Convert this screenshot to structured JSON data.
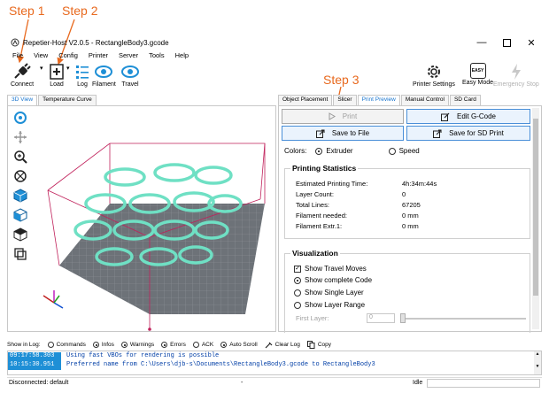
{
  "annotations": {
    "step1": "Step 1",
    "step2": "Step 2",
    "step3": "Step 3",
    "color": "#e8691e"
  },
  "window": {
    "title": "Repetier-Host V2.0.5 - RectangleBody3.gcode",
    "minimize_icon": "minimize-icon",
    "maximize_icon": "maximize-icon",
    "close_icon": "close-icon"
  },
  "menu": [
    "File",
    "View",
    "Config",
    "Printer",
    "Server",
    "Tools",
    "Help"
  ],
  "toolbar": {
    "connect": "Connect",
    "load": "Load",
    "log": "Log",
    "filament": "Filament",
    "travel": "Travel",
    "printer_settings": "Printer Settings",
    "easy_mode": "Easy Mode",
    "easy_badge": "EASY",
    "emergency_stop": "Emergency Stop"
  },
  "left_tabs": [
    "3D View",
    "Temperature Curve"
  ],
  "right_tabs": [
    "Object Placement",
    "Slicer",
    "Print Preview",
    "Manual Control",
    "SD Card"
  ],
  "buttons": {
    "print": "Print",
    "edit_gcode": "Edit G-Code",
    "save_file": "Save to File",
    "save_sd": "Save for SD Print"
  },
  "colors_row": {
    "label": "Colors:",
    "extruder": "Extruder",
    "speed": "Speed"
  },
  "printing_statistics": {
    "title": "Printing Statistics",
    "rows": [
      {
        "label": "Estimated Printing Time:",
        "value": "4h:34m:44s"
      },
      {
        "label": "Layer Count:",
        "value": "0"
      },
      {
        "label": "Total Lines:",
        "value": "67205"
      },
      {
        "label": "Filament needed:",
        "value": "0 mm"
      },
      {
        "label": "Filament Extr.1:",
        "value": "0 mm"
      }
    ]
  },
  "visualization": {
    "title": "Visualization",
    "show_travel": "Show Travel Moves",
    "show_complete": "Show complete Code",
    "show_single": "Show Single Layer",
    "show_range": "Show Layer Range",
    "first_layer_label": "First Layer:",
    "first_layer_value": "0"
  },
  "logbar": {
    "show_in_log": "Show in Log:",
    "commands": "Commands",
    "infos": "Infos",
    "warnings": "Warnings",
    "errors": "Errors",
    "ack": "ACK",
    "auto_scroll": "Auto Scroll",
    "clear_log": "Clear Log",
    "copy": "Copy"
  },
  "log": [
    {
      "time": "09:17:58.303",
      "msg": "Using fast VBOs for rendering is possible"
    },
    {
      "time": "10:15:30.951",
      "msg": "Preferred name from C:\\Users\\djb-s\\Documents\\RectangleBody3.gcode to RectangleBody3"
    }
  ],
  "status": {
    "left": "Disconnected: default",
    "middle": "-",
    "right": "Idle"
  }
}
